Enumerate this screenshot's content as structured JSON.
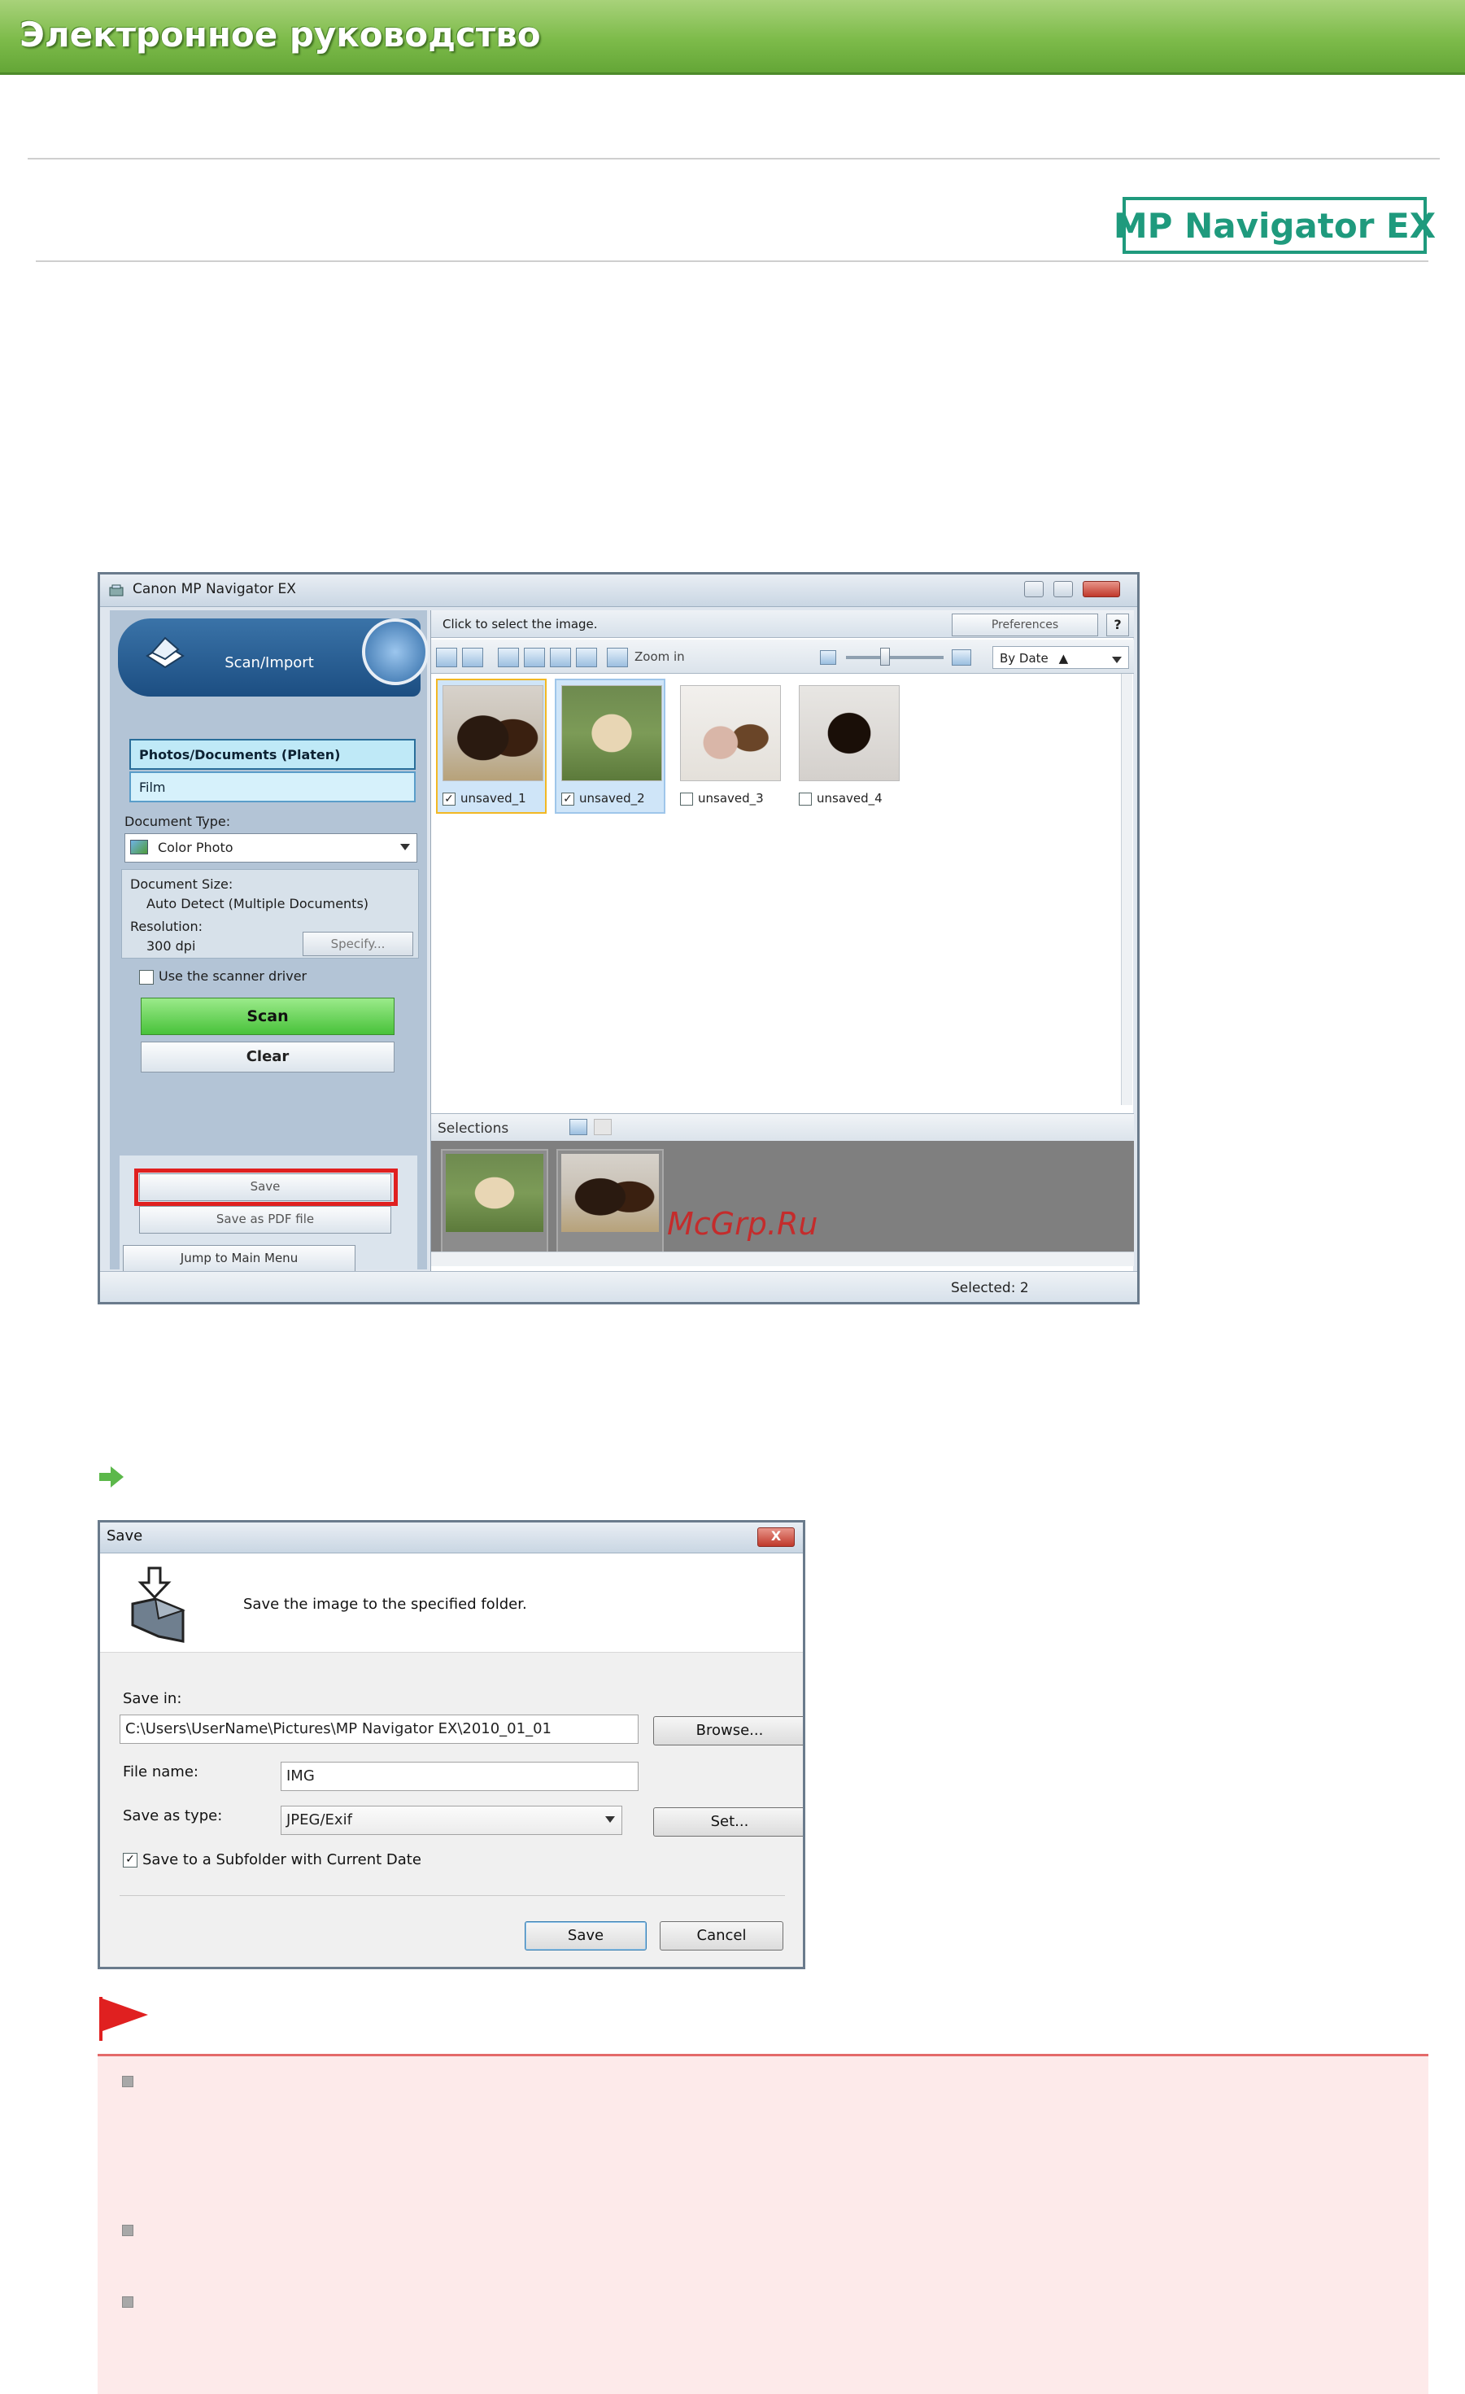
{
  "banner": {
    "title": "Электронное руководство"
  },
  "product_logo": "MP Navigator EX",
  "main_window": {
    "title": "Canon MP Navigator EX",
    "mode_title": "Scan/Import",
    "source_options": [
      "Photos/Documents (Platen)",
      "Film"
    ],
    "document_type_label": "Document Type:",
    "document_type_value": "Color Photo",
    "document_size_label": "Document Size:",
    "document_size_value": "Auto Detect (Multiple Documents)",
    "resolution_label": "Resolution:",
    "resolution_value": "300 dpi",
    "specify_label": "Specify...",
    "use_driver_label": "Use the scanner driver",
    "scan_label": "Scan",
    "clear_label": "Clear",
    "save_label": "Save",
    "save_pdf_label": "Save as PDF file",
    "jump_label": "Jump to Main Menu",
    "click_hint": "Click to select the image.",
    "preferences_label": "Preferences",
    "help_label": "?",
    "zoom_label": "Zoom in",
    "sort_label": "By Date",
    "thumbnails": [
      {
        "caption": "unsaved_1",
        "checked": true
      },
      {
        "caption": "unsaved_2",
        "checked": true
      },
      {
        "caption": "unsaved_3",
        "checked": false
      },
      {
        "caption": "unsaved_4",
        "checked": false
      }
    ],
    "selections_label": "Selections",
    "watermark": "McGrp.Ru",
    "status_selected": "Selected: 2"
  },
  "save_dialog": {
    "title": "Save",
    "close_label": "X",
    "description": "Save the image to the specified folder.",
    "save_in_label": "Save in:",
    "save_in_value": "C:\\Users\\UserName\\Pictures\\MP Navigator EX\\2010_01_01",
    "browse_label": "Browse...",
    "file_name_label": "File name:",
    "file_name_value": "IMG",
    "save_type_label": "Save as type:",
    "save_type_value": "JPEG/Exif",
    "set_label": "Set...",
    "subfolder_label": "Save to a Subfolder with Current Date",
    "subfolder_checked": true,
    "save_button": "Save",
    "cancel_button": "Cancel"
  },
  "colors": {
    "banner_green": "#7dbb4a",
    "logo_teal": "#1f9a7d",
    "highlight_red": "#e02020",
    "important_bg": "#fdeaea",
    "important_rule": "#e46a6a"
  }
}
